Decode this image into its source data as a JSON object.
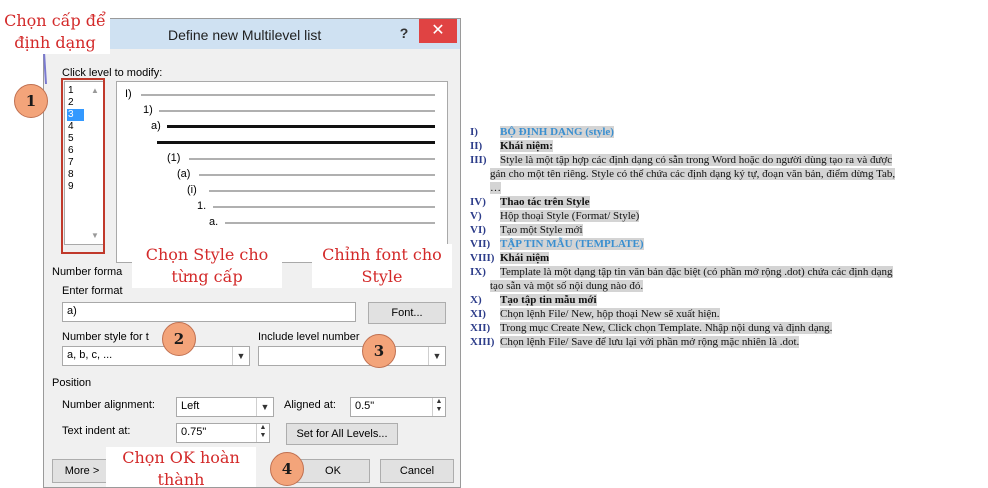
{
  "dialog": {
    "title": "Define new Multilevel list",
    "help": "?",
    "close": "✕",
    "click_level_label": "Click level to modify:",
    "levels": [
      "1",
      "2",
      "3",
      "4",
      "5",
      "6",
      "7",
      "8",
      "9"
    ],
    "selected_level": "3",
    "preview_rows": [
      {
        "label": "I)"
      },
      {
        "label": "1)"
      },
      {
        "label": "a)"
      },
      {
        "label": ""
      },
      {
        "label": "(1)"
      },
      {
        "label": "(a)"
      },
      {
        "label": "(i)"
      },
      {
        "label": "1."
      },
      {
        "label": "a."
      }
    ],
    "number_format_label": "Number forma",
    "enter_format_label": "Enter format",
    "format_value": "a)",
    "font_button": "Font...",
    "number_style_label": "Number style for t",
    "number_style_value": "a, b, c, ...",
    "include_level_label": "Include level number",
    "position_label": "Position",
    "number_alignment_label": "Number alignment:",
    "number_alignment_value": "Left",
    "aligned_at_label": "Aligned at:",
    "aligned_at_value": "0.5\"",
    "text_indent_label": "Text indent at:",
    "text_indent_value": "0.75\"",
    "set_all_button": "Set for All Levels...",
    "more_button": "More >",
    "ok_button": "OK",
    "cancel_button": "Cancel"
  },
  "annotations": {
    "choose_level": "Chọn cấp để định dạng",
    "choose_style": "Chọn Style cho từng cấp",
    "font_style": "Chỉnh font cho Style",
    "ok_done": "Chọn OK hoàn thành",
    "circles": [
      "1",
      "2",
      "3",
      "4"
    ]
  },
  "outline": [
    {
      "num": "I)",
      "text": "BỘ ĐỊNH DẠNG (style)",
      "style": "blue"
    },
    {
      "num": "II)",
      "text": "Khái niệm:",
      "style": "bold"
    },
    {
      "num": "III)",
      "text": "Style là một tập hợp các định dạng có sẵn trong Word hoặc do người dùng tạo ra và được",
      "style": "plain"
    },
    {
      "num": "",
      "text": "gán cho một tên riêng. Style có thể chứa các định dạng ký tự, đoạn văn bản, điểm dừng Tab,",
      "style": "plain"
    },
    {
      "num": "",
      "text": "…",
      "style": "plain"
    },
    {
      "num": "IV)",
      "text": "Thao tác trên Style",
      "style": "bold"
    },
    {
      "num": "V)",
      "text": "Hộp thoại Style (Format/ Style)",
      "style": "plain"
    },
    {
      "num": "VI)",
      "text": "Tạo một Style mới",
      "style": "plain"
    },
    {
      "num": "VII)",
      "text": "TẬP TIN MẪU (TEMPLATE)",
      "style": "blue"
    },
    {
      "num": "VIII)",
      "text": "Khái niệm",
      "style": "bold"
    },
    {
      "num": "IX)",
      "text": "Template là một dạng tập tin văn bản đặc biệt (có phần mở rộng .dot) chứa các định dạng",
      "style": "plain"
    },
    {
      "num": "",
      "text": "tạo sẵn và một số nội dung nào đó.",
      "style": "plain"
    },
    {
      "num": "X)",
      "text": "Tạo tập tin mẫu mới",
      "style": "bold"
    },
    {
      "num": "XI)",
      "text": "Chọn lệnh File/ New, hộp thoại New sẽ xuất hiện.",
      "style": "plain"
    },
    {
      "num": "XII)",
      "text": "Trong mục Create New, Click chọn Template. Nhập nội dung và định dạng.",
      "style": "plain"
    },
    {
      "num": "XIII)",
      "text": "Chọn lệnh File/ Save để lưu lại với phần mở rộng mặc nhiên là .dot.",
      "style": "plain"
    }
  ]
}
